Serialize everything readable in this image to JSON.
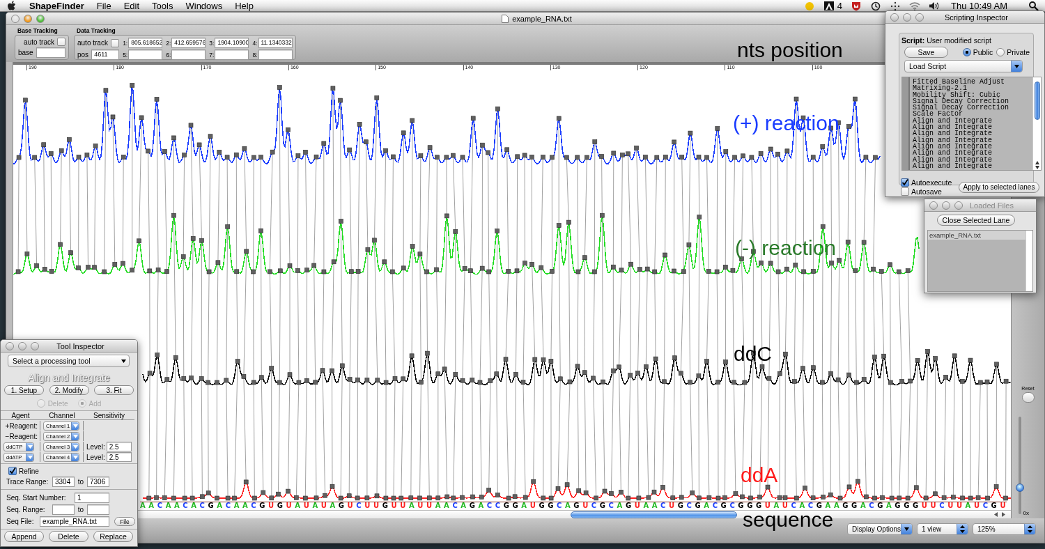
{
  "menu_bar": {
    "app": "ShapeFinder",
    "items": [
      "File",
      "Edit",
      "Tools",
      "Windows",
      "Help"
    ],
    "status_count": "4",
    "clock": "Thu 10:49 AM"
  },
  "main_window": {
    "title": "example_RNA.txt",
    "base_tracking": {
      "title": "Base Tracking",
      "auto_track_label": "auto track",
      "auto_track_checked": false,
      "base_label": "base"
    },
    "data_tracking": {
      "title": "Data Tracking",
      "auto_track_label": "auto track",
      "auto_track_checked": false,
      "pos_label": "pos",
      "pos_value": "4611",
      "channels": [
        {
          "label": "1:",
          "value": "805.618652"
        },
        {
          "label": "2:",
          "value": "412.659576"
        },
        {
          "label": "3:",
          "value": "1904.10900"
        },
        {
          "label": "4:",
          "value": "11.1340332"
        },
        {
          "label": "5:"
        },
        {
          "label": "6:"
        },
        {
          "label": "7:"
        },
        {
          "label": "8:"
        }
      ]
    },
    "ruler_ticks": [
      "190",
      "180",
      "170",
      "160",
      "150",
      "140",
      "130",
      "120",
      "110",
      "100"
    ],
    "traces": [
      {
        "color": "#1a3cff"
      },
      {
        "color": "#22dd22"
      },
      {
        "color": "#000000"
      },
      {
        "color": "#ff2020"
      }
    ],
    "annotations": [
      {
        "text": "nts position",
        "color": "#000000"
      },
      {
        "text": "(+) reaction",
        "color": "#1a3cff"
      },
      {
        "text": "(-) reaction",
        "color": "#2a7a2a"
      },
      {
        "text": "ddC",
        "color": "#000000"
      },
      {
        "text": "ddA",
        "color": "#ff1a1a"
      },
      {
        "text": "sequence",
        "color": "#000000"
      }
    ],
    "sequence": [
      {
        "base": "A",
        "color": "#22bb22"
      },
      {
        "base": "A",
        "color": "#22bb22"
      },
      {
        "base": "C",
        "color": "#2244ff"
      },
      {
        "base": "A",
        "color": "#22bb22"
      },
      {
        "base": "A",
        "color": "#22bb22"
      },
      {
        "base": "C",
        "color": "#2244ff"
      },
      {
        "base": "A",
        "color": "#22bb22"
      },
      {
        "base": "C",
        "color": "#2244ff"
      },
      {
        "base": "G",
        "color": "#000000"
      },
      {
        "base": "A",
        "color": "#22bb22"
      },
      {
        "base": "C",
        "color": "#2244ff"
      },
      {
        "base": "A",
        "color": "#22bb22"
      },
      {
        "base": "A",
        "color": "#22bb22"
      },
      {
        "base": "C",
        "color": "#2244ff"
      },
      {
        "base": "G",
        "color": "#000000"
      },
      {
        "base": "U",
        "color": "#ff2020"
      },
      {
        "base": "G",
        "color": "#000000"
      },
      {
        "base": "U",
        "color": "#ff2020"
      },
      {
        "base": "A",
        "color": "#22bb22"
      },
      {
        "base": "U",
        "color": "#ff2020"
      },
      {
        "base": "A",
        "color": "#22bb22"
      },
      {
        "base": "U",
        "color": "#ff2020"
      },
      {
        "base": "A",
        "color": "#22bb22"
      },
      {
        "base": "G",
        "color": "#000000"
      },
      {
        "base": "U",
        "color": "#ff2020"
      },
      {
        "base": "C",
        "color": "#2244ff"
      },
      {
        "base": "U",
        "color": "#ff2020"
      },
      {
        "base": "U",
        "color": "#ff2020"
      },
      {
        "base": "G",
        "color": "#000000"
      },
      {
        "base": "U",
        "color": "#ff2020"
      },
      {
        "base": "U",
        "color": "#ff2020"
      },
      {
        "base": "A",
        "color": "#22bb22"
      },
      {
        "base": "U",
        "color": "#ff2020"
      },
      {
        "base": "U",
        "color": "#ff2020"
      },
      {
        "base": "A",
        "color": "#22bb22"
      },
      {
        "base": "A",
        "color": "#22bb22"
      },
      {
        "base": "C",
        "color": "#2244ff"
      },
      {
        "base": "A",
        "color": "#22bb22"
      },
      {
        "base": "G",
        "color": "#000000"
      },
      {
        "base": "A",
        "color": "#22bb22"
      },
      {
        "base": "C",
        "color": "#2244ff"
      },
      {
        "base": "C",
        "color": "#2244ff"
      },
      {
        "base": "G",
        "color": "#000000"
      },
      {
        "base": "G",
        "color": "#000000"
      },
      {
        "base": "A",
        "color": "#22bb22"
      },
      {
        "base": "U",
        "color": "#ff2020"
      },
      {
        "base": "G",
        "color": "#000000"
      },
      {
        "base": "G",
        "color": "#000000"
      },
      {
        "base": "C",
        "color": "#2244ff"
      },
      {
        "base": "A",
        "color": "#22bb22"
      },
      {
        "base": "G",
        "color": "#000000"
      },
      {
        "base": "U",
        "color": "#ff2020"
      },
      {
        "base": "C",
        "color": "#2244ff"
      },
      {
        "base": "G",
        "color": "#000000"
      },
      {
        "base": "C",
        "color": "#2244ff"
      },
      {
        "base": "A",
        "color": "#22bb22"
      },
      {
        "base": "G",
        "color": "#000000"
      },
      {
        "base": "U",
        "color": "#ff2020"
      },
      {
        "base": "A",
        "color": "#22bb22"
      },
      {
        "base": "A",
        "color": "#22bb22"
      },
      {
        "base": "C",
        "color": "#2244ff"
      },
      {
        "base": "U",
        "color": "#ff2020"
      },
      {
        "base": "G",
        "color": "#000000"
      },
      {
        "base": "C",
        "color": "#2244ff"
      },
      {
        "base": "G",
        "color": "#000000"
      },
      {
        "base": "A",
        "color": "#22bb22"
      },
      {
        "base": "C",
        "color": "#2244ff"
      },
      {
        "base": "G",
        "color": "#000000"
      },
      {
        "base": "C",
        "color": "#2244ff"
      },
      {
        "base": "G",
        "color": "#000000"
      },
      {
        "base": "G",
        "color": "#000000"
      },
      {
        "base": "G",
        "color": "#000000"
      },
      {
        "base": "U",
        "color": "#ff2020"
      },
      {
        "base": "A",
        "color": "#22bb22"
      },
      {
        "base": "U",
        "color": "#ff2020"
      },
      {
        "base": "C",
        "color": "#2244ff"
      },
      {
        "base": "A",
        "color": "#22bb22"
      },
      {
        "base": "C",
        "color": "#2244ff"
      },
      {
        "base": "G",
        "color": "#000000"
      },
      {
        "base": "A",
        "color": "#22bb22"
      },
      {
        "base": "A",
        "color": "#22bb22"
      },
      {
        "base": "G",
        "color": "#000000"
      },
      {
        "base": "G",
        "color": "#000000"
      },
      {
        "base": "A",
        "color": "#22bb22"
      },
      {
        "base": "C",
        "color": "#2244ff"
      },
      {
        "base": "G",
        "color": "#000000"
      },
      {
        "base": "A",
        "color": "#22bb22"
      },
      {
        "base": "G",
        "color": "#000000"
      },
      {
        "base": "G",
        "color": "#000000"
      },
      {
        "base": "G",
        "color": "#000000"
      },
      {
        "base": "U",
        "color": "#ff2020"
      },
      {
        "base": "U",
        "color": "#ff2020"
      },
      {
        "base": "C",
        "color": "#2244ff"
      },
      {
        "base": "U",
        "color": "#ff2020"
      },
      {
        "base": "U",
        "color": "#ff2020"
      },
      {
        "base": "A",
        "color": "#22bb22"
      },
      {
        "base": "U",
        "color": "#ff2020"
      },
      {
        "base": "C",
        "color": "#2244ff"
      },
      {
        "base": "G",
        "color": "#000000"
      },
      {
        "base": "U",
        "color": "#ff2020"
      }
    ],
    "zoom_slider": {
      "reset_label": "Reset",
      "scale_label": "0x",
      "level": 0.25
    },
    "popups": [
      {
        "label": "Display Options",
        "kind": "menu"
      },
      {
        "label": "1 view",
        "kind": "stepper"
      },
      {
        "label": "125%",
        "kind": "stepper"
      }
    ]
  },
  "scripting_inspector": {
    "title": "Scripting Inspector",
    "script": "**Script:** User modified script",
    "save": "Save",
    "visibility": [
      {
        "label": "Public",
        "selected": true
      },
      {
        "label": "Private",
        "selected": false
      }
    ],
    "load_script": "Load Script",
    "steps": [
      "Fitted Baseline Adjust",
      "Matrixing-2.1",
      "Mobility Shift: Cubic",
      "Signal Decay Correction",
      "Signal Decay Correction",
      "Scale Factor",
      "Align and Integrate",
      "Align and Integrate",
      "Align and Integrate",
      "Align and Integrate",
      "Align and Integrate",
      "Align and Integrate",
      "Align and Integrate",
      "Align and Integrate"
    ],
    "options": [
      {
        "label": "Autoexecute",
        "checked": true
      },
      {
        "label": "Autosave",
        "checked": false
      }
    ],
    "apply": "Apply to selected lanes"
  },
  "loaded_files": {
    "title": "Loaded Files",
    "close": "Close Selected Lane",
    "files": [
      "example_RNA.txt"
    ]
  },
  "tool_inspector": {
    "title": "Tool Inspector",
    "tool_select": "Select a processing tool",
    "tool_name": "Align and Integrate",
    "steps": [
      "1. Setup",
      "2. Modify",
      "3. Fit"
    ],
    "mode": [
      {
        "label": "Delete",
        "selected": false,
        "disabled": true
      },
      {
        "label": "Add",
        "selected": true,
        "disabled": true
      }
    ],
    "headers": [
      "Agent",
      "Channel",
      "Sensitivity"
    ],
    "rows": [
      {
        "kind": "label",
        "agent": "+Reagent:",
        "channel": "Channel 1"
      },
      {
        "kind": "label",
        "agent": "−Reagent:",
        "channel": "Channel 2"
      },
      {
        "kind": "select",
        "agent": "ddCTP",
        "channel": "Channel 3",
        "level_label": "Level:",
        "level_value": "2.5"
      },
      {
        "kind": "select",
        "agent": "ddATP",
        "channel": "Channel 4",
        "level_label": "Level:",
        "level_value": "2.5"
      }
    ],
    "refine": {
      "label": "Refine",
      "checked": true
    },
    "trace_range": {
      "label": "Trace Range:",
      "from": "3304",
      "to_label": "to",
      "to": "7306"
    },
    "seq_start": {
      "label": "Seq. Start Number:",
      "value": "1"
    },
    "seq_range": {
      "label": "Seq. Range:",
      "to_label": "to"
    },
    "seq_file": {
      "label": "Seq File:",
      "value": "example_RNA.txt",
      "button": "File"
    },
    "actions": [
      "Append",
      "Delete",
      "Replace"
    ]
  }
}
